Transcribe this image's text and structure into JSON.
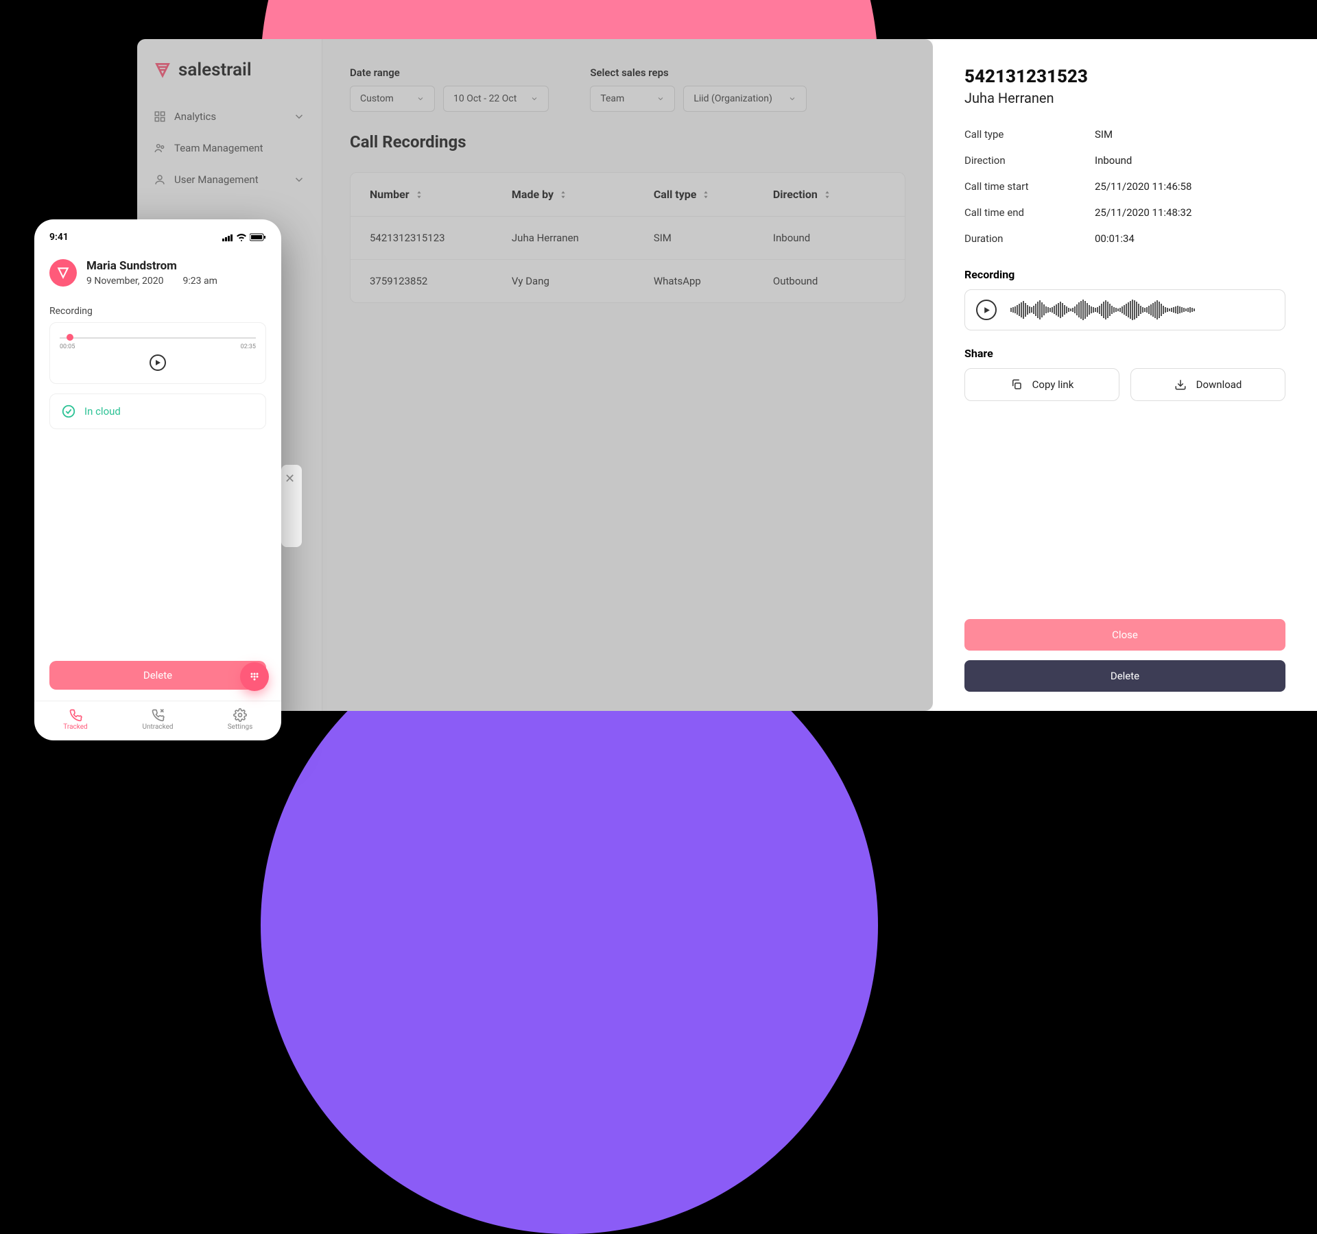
{
  "brand": "salestrail",
  "sidebar": {
    "items": [
      {
        "label": "Analytics",
        "icon": "grid-icon",
        "expandable": true
      },
      {
        "label": "Team Management",
        "icon": "team-icon",
        "expandable": false
      },
      {
        "label": "User Management",
        "icon": "user-icon",
        "expandable": true
      }
    ]
  },
  "filters": {
    "date_range_label": "Date range",
    "date_range_preset": "Custom",
    "date_range_value": "10 Oct - 22 Oct",
    "select_reps_label": "Select sales reps",
    "team_select": "Team",
    "org_select": "Liid (Organization)"
  },
  "section_title": "Call Recordings",
  "table": {
    "columns": [
      "Number",
      "Made by",
      "Call type",
      "Direction"
    ],
    "rows": [
      {
        "number": "5421312315123",
        "made_by": "Juha Herranen",
        "call_type": "SIM",
        "direction": "Inbound"
      },
      {
        "number": "3759123852",
        "made_by": "Vy Dang",
        "call_type": "WhatsApp",
        "direction": "Outbound"
      }
    ]
  },
  "mobile": {
    "time": "9:41",
    "name": "Maria Sundstrom",
    "date": "9 November, 2020",
    "call_time": "9:23 am",
    "recording_label": "Recording",
    "slider": {
      "start": "00:05",
      "end": "02:35"
    },
    "cloud_status": "In cloud",
    "delete_label": "Delete",
    "tabs": [
      {
        "label": "Tracked",
        "active": true
      },
      {
        "label": "Untracked",
        "active": false
      },
      {
        "label": "Settings",
        "active": false
      }
    ]
  },
  "detail": {
    "number": "542131231523",
    "name": "Juha Herranen",
    "rows": [
      {
        "label": "Call type",
        "value": "SIM"
      },
      {
        "label": "Direction",
        "value": "Inbound"
      },
      {
        "label": "Call time start",
        "value": "25/11/2020 11:46:58"
      },
      {
        "label": "Call time end",
        "value": "25/11/2020 11:48:32"
      },
      {
        "label": "Duration",
        "value": "00:01:34"
      }
    ],
    "recording_label": "Recording",
    "share_label": "Share",
    "copy_link": "Copy link",
    "download": "Download",
    "close": "Close",
    "delete": "Delete"
  }
}
